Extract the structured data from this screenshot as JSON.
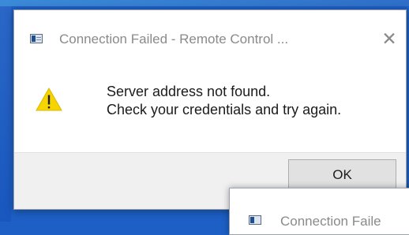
{
  "main_dialog": {
    "title": "Connection Failed - Remote Control ...",
    "close_glyph": "✕",
    "icon": "app-window-icon",
    "warning_icon": "warning-triangle-icon",
    "message_line1": "Server address not found.",
    "message_line2": "Check your credentials and try again.",
    "ok_label": "OK"
  },
  "background_dialog": {
    "icon": "app-window-icon",
    "title_visible": "Connection Faile"
  },
  "colors": {
    "desktop_blue": "#1d5fc4",
    "warning_yellow": "#f5d400",
    "title_gray": "#8a8a8a",
    "footer_gray": "#f0f0f0"
  }
}
